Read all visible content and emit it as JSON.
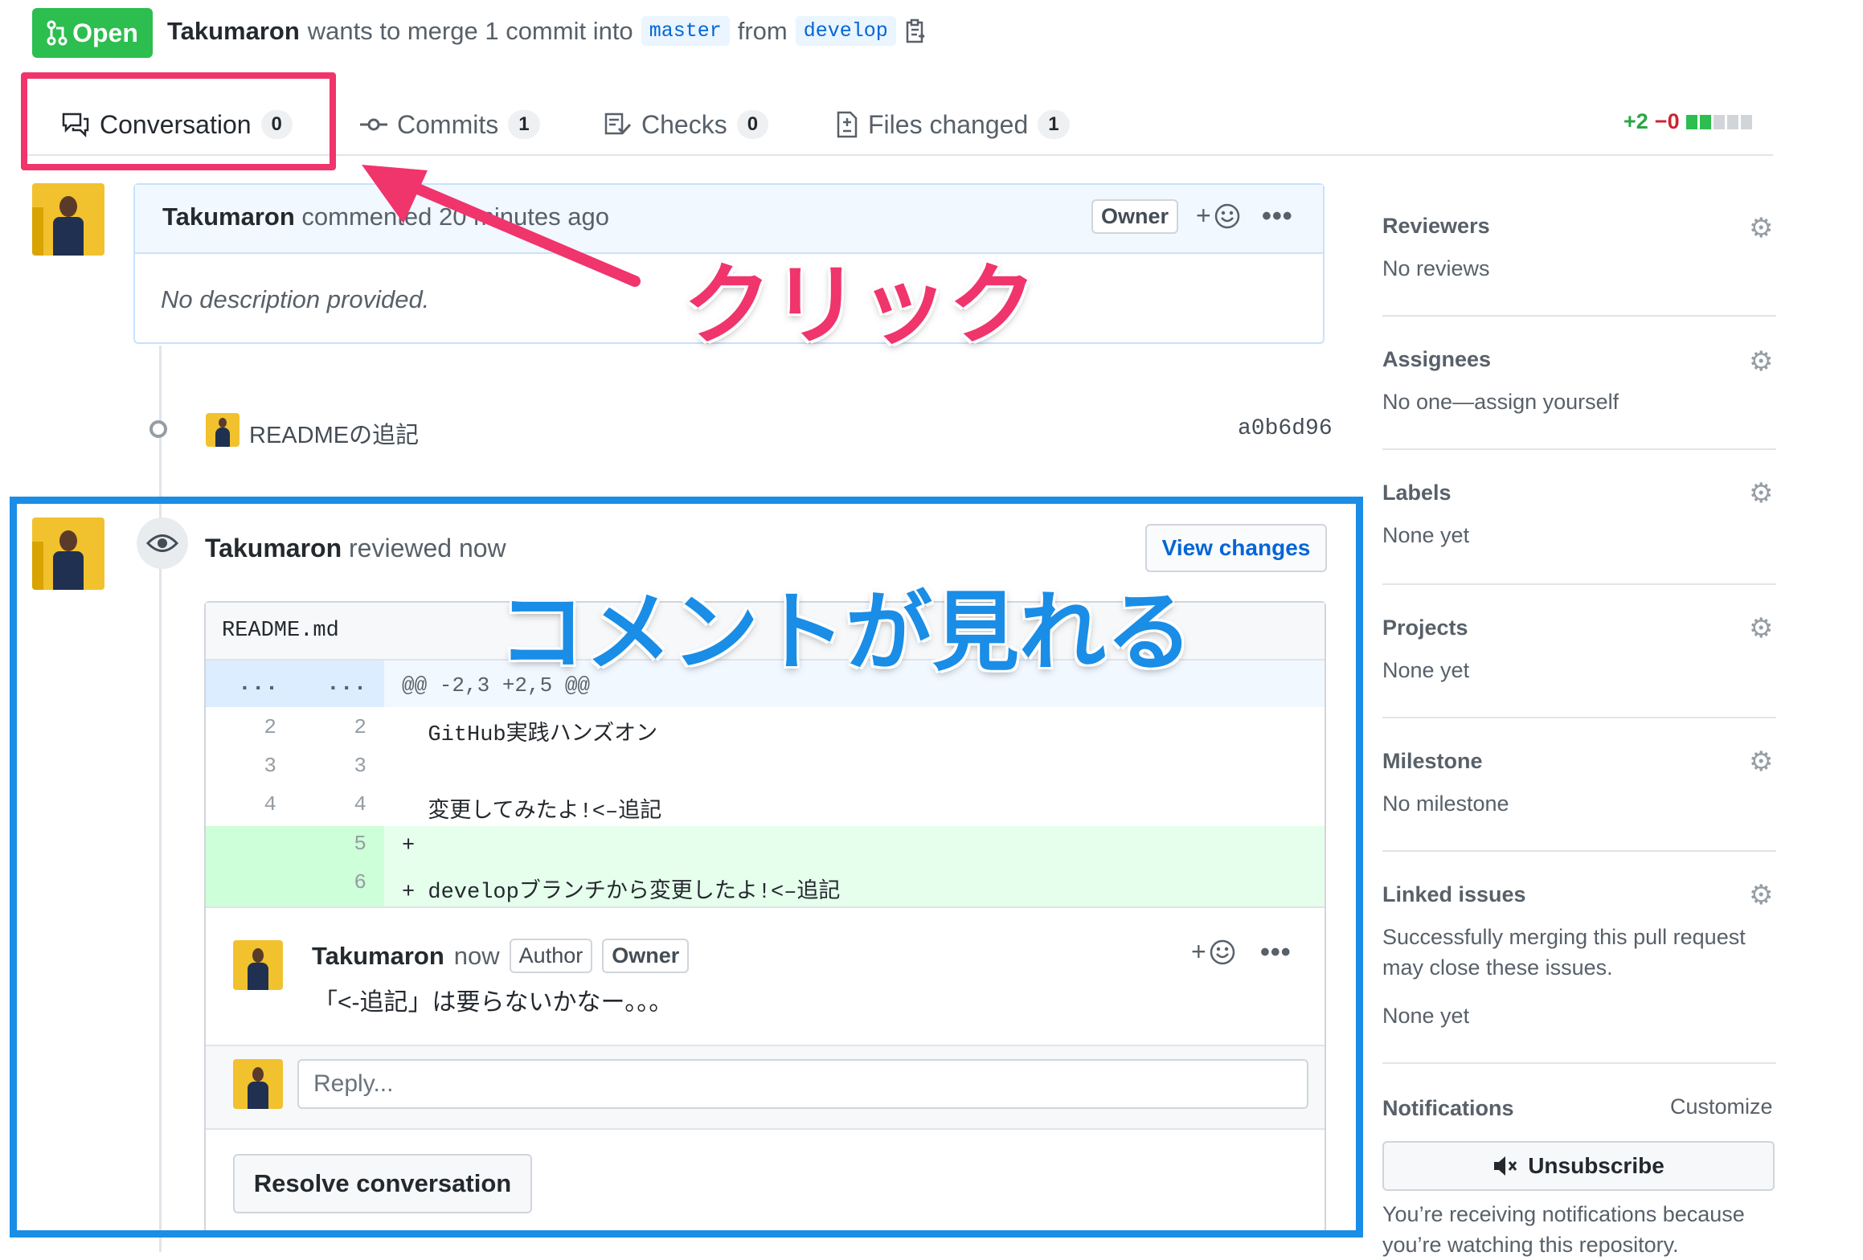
{
  "header": {
    "state_label": "Open",
    "author": "Takumaron",
    "merge_text": "wants to merge 1 commit into",
    "base_branch": "master",
    "from_text": "from",
    "head_branch": "develop"
  },
  "tabs": [
    {
      "label": "Conversation",
      "count": "0"
    },
    {
      "label": "Commits",
      "count": "1"
    },
    {
      "label": "Checks",
      "count": "0"
    },
    {
      "label": "Files changed",
      "count": "1"
    }
  ],
  "diffstat": {
    "additions": "+2",
    "deletions": "−0"
  },
  "annotations": {
    "click_text": "クリック",
    "see_comments_text": "コメントが見れる"
  },
  "comment": {
    "author": "Takumaron",
    "action": "commented 20 minutes ago",
    "role_label": "Owner",
    "body": "No description provided."
  },
  "commit": {
    "message": "READMEの追記",
    "sha": "a0b6d96"
  },
  "review": {
    "author": "Takumaron",
    "action": "reviewed now",
    "view_changes_label": "View changes",
    "file_name": "README.md",
    "hunk_left": "...",
    "hunk_right": "...",
    "hunk_header": "@@ -2,3 +2,5 @@",
    "lines": [
      {
        "old": "2",
        "new": "2",
        "code": "  GitHub実践ハンズオン"
      },
      {
        "old": "3",
        "new": "3",
        "code": ""
      },
      {
        "old": "4",
        "new": "4",
        "code": "  変更してみたよ!<–追記"
      },
      {
        "old": "",
        "new": "5",
        "code": "+"
      },
      {
        "old": "",
        "new": "6",
        "code": "+ developブランチから変更したよ!<–追記"
      }
    ],
    "inline_comment": {
      "author": "Takumaron",
      "time": "now",
      "author_label": "Author",
      "owner_label": "Owner",
      "body": "「<-追記」は要らないかなー。。。"
    },
    "reply_placeholder": "Reply...",
    "resolve_label": "Resolve conversation"
  },
  "sidebar": {
    "reviewers": {
      "title": "Reviewers",
      "value": "No reviews"
    },
    "assignees": {
      "title": "Assignees",
      "value": "No one—assign yourself"
    },
    "labels": {
      "title": "Labels",
      "value": "None yet"
    },
    "projects": {
      "title": "Projects",
      "value": "None yet"
    },
    "milestone": {
      "title": "Milestone",
      "value": "No milestone"
    },
    "linked_issues": {
      "title": "Linked issues",
      "description": "Successfully merging this pull request may close these issues.",
      "value": "None yet"
    },
    "notifications": {
      "title": "Notifications",
      "customize": "Customize",
      "unsubscribe_label": "Unsubscribe",
      "reason": "You’re receiving notifications because you’re watching this repository."
    }
  },
  "colors": {
    "open_green": "#2cbe4e",
    "annotation_red": "#f0346c",
    "annotation_blue": "#1a8de6",
    "link_blue": "#0366d6"
  }
}
